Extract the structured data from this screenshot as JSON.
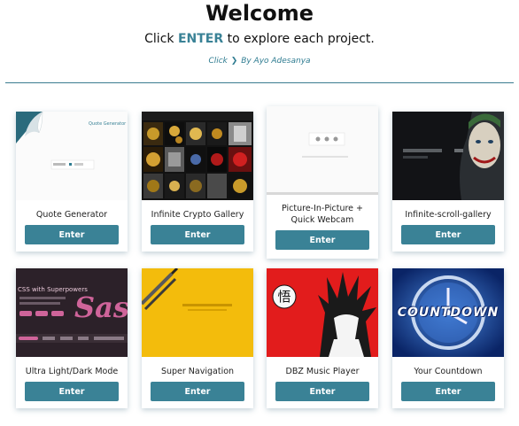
{
  "header": {
    "title": "Welcome",
    "subtitle_pre": "Click ",
    "subtitle_accent": "ENTER",
    "subtitle_post": " to explore each project.",
    "credit_pre": "Click",
    "credit_post": "By Ayo Adesanya"
  },
  "colors": {
    "accent": "#3a8296",
    "divider": "#3a7d90"
  },
  "projects": [
    {
      "title": "Quote Generator",
      "button": "Enter",
      "thumb_text": "Quote Generator"
    },
    {
      "title": "Infinite Crypto Gallery",
      "button": "Enter"
    },
    {
      "title_line1": "Picture-In-Picture +",
      "title_line2": "Quick Webcam",
      "button": "Enter"
    },
    {
      "title": "Infinite-scroll-gallery",
      "button": "Enter"
    },
    {
      "title": "Ultra Light/Dark Mode",
      "button": "Enter",
      "thumb_text": "CSS with Superpowers",
      "thumb_logo": "Sass"
    },
    {
      "title": "Super Navigation",
      "button": "Enter"
    },
    {
      "title": "DBZ Music Player",
      "button": "Enter",
      "thumb_glyph": "悟"
    },
    {
      "title": "Your Countdown",
      "button": "Enter",
      "thumb_text": "COUNTDOWN"
    }
  ]
}
